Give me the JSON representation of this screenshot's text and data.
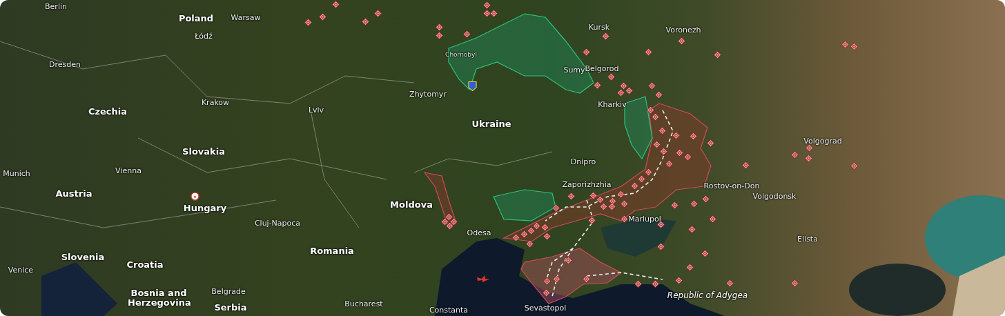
{
  "map": {
    "labels": [
      {
        "text": "Berlin",
        "kind": "city"
      },
      {
        "text": "Poland",
        "kind": "country"
      },
      {
        "text": "Warsaw",
        "kind": "city"
      },
      {
        "text": "Łódź",
        "kind": "city"
      },
      {
        "text": "Dresden",
        "kind": "city"
      },
      {
        "text": "Chornobyl",
        "kind": "small"
      },
      {
        "text": "Zhytomyr",
        "kind": "city"
      },
      {
        "text": "Krakow",
        "kind": "city"
      },
      {
        "text": "Czechia",
        "kind": "country"
      },
      {
        "text": "Lviv",
        "kind": "city"
      },
      {
        "text": "Ukraine",
        "kind": "country"
      },
      {
        "text": "Kursk",
        "kind": "city"
      },
      {
        "text": "Voronezh",
        "kind": "city"
      },
      {
        "text": "Sumy",
        "kind": "city"
      },
      {
        "text": "Belgorod",
        "kind": "city"
      },
      {
        "text": "Kharkiv",
        "kind": "city"
      },
      {
        "text": "Volgograd",
        "kind": "city"
      },
      {
        "text": "Slovakia",
        "kind": "country"
      },
      {
        "text": "Munich",
        "kind": "city"
      },
      {
        "text": "Vienna",
        "kind": "city"
      },
      {
        "text": "Dnipro",
        "kind": "city"
      },
      {
        "text": "Zaporizhzhia",
        "kind": "city"
      },
      {
        "text": "Austria",
        "kind": "country"
      },
      {
        "text": "Hungary",
        "kind": "country"
      },
      {
        "text": "Moldova",
        "kind": "country"
      },
      {
        "text": "Cluj-Napoca",
        "kind": "city"
      },
      {
        "text": "Volgodonsk",
        "kind": "city"
      },
      {
        "text": "Mariupol",
        "kind": "city"
      },
      {
        "text": "Rostov-on-Don",
        "kind": "city"
      },
      {
        "text": "Odesa",
        "kind": "city"
      },
      {
        "text": "Romania",
        "kind": "country"
      },
      {
        "text": "Elista",
        "kind": "city"
      },
      {
        "text": "Slovenia",
        "kind": "country"
      },
      {
        "text": "Croatia",
        "kind": "country"
      },
      {
        "text": "Venice",
        "kind": "city"
      },
      {
        "text": "Bosnia and Herzegovina",
        "kind": "country"
      },
      {
        "text": "Belgrade",
        "kind": "city"
      },
      {
        "text": "Serbia",
        "kind": "country"
      },
      {
        "text": "Bucharest",
        "kind": "city"
      },
      {
        "text": "Constanta",
        "kind": "city"
      },
      {
        "text": "Sevastopol",
        "kind": "city"
      },
      {
        "text": "Republic of Adygea",
        "kind": "region"
      }
    ]
  }
}
